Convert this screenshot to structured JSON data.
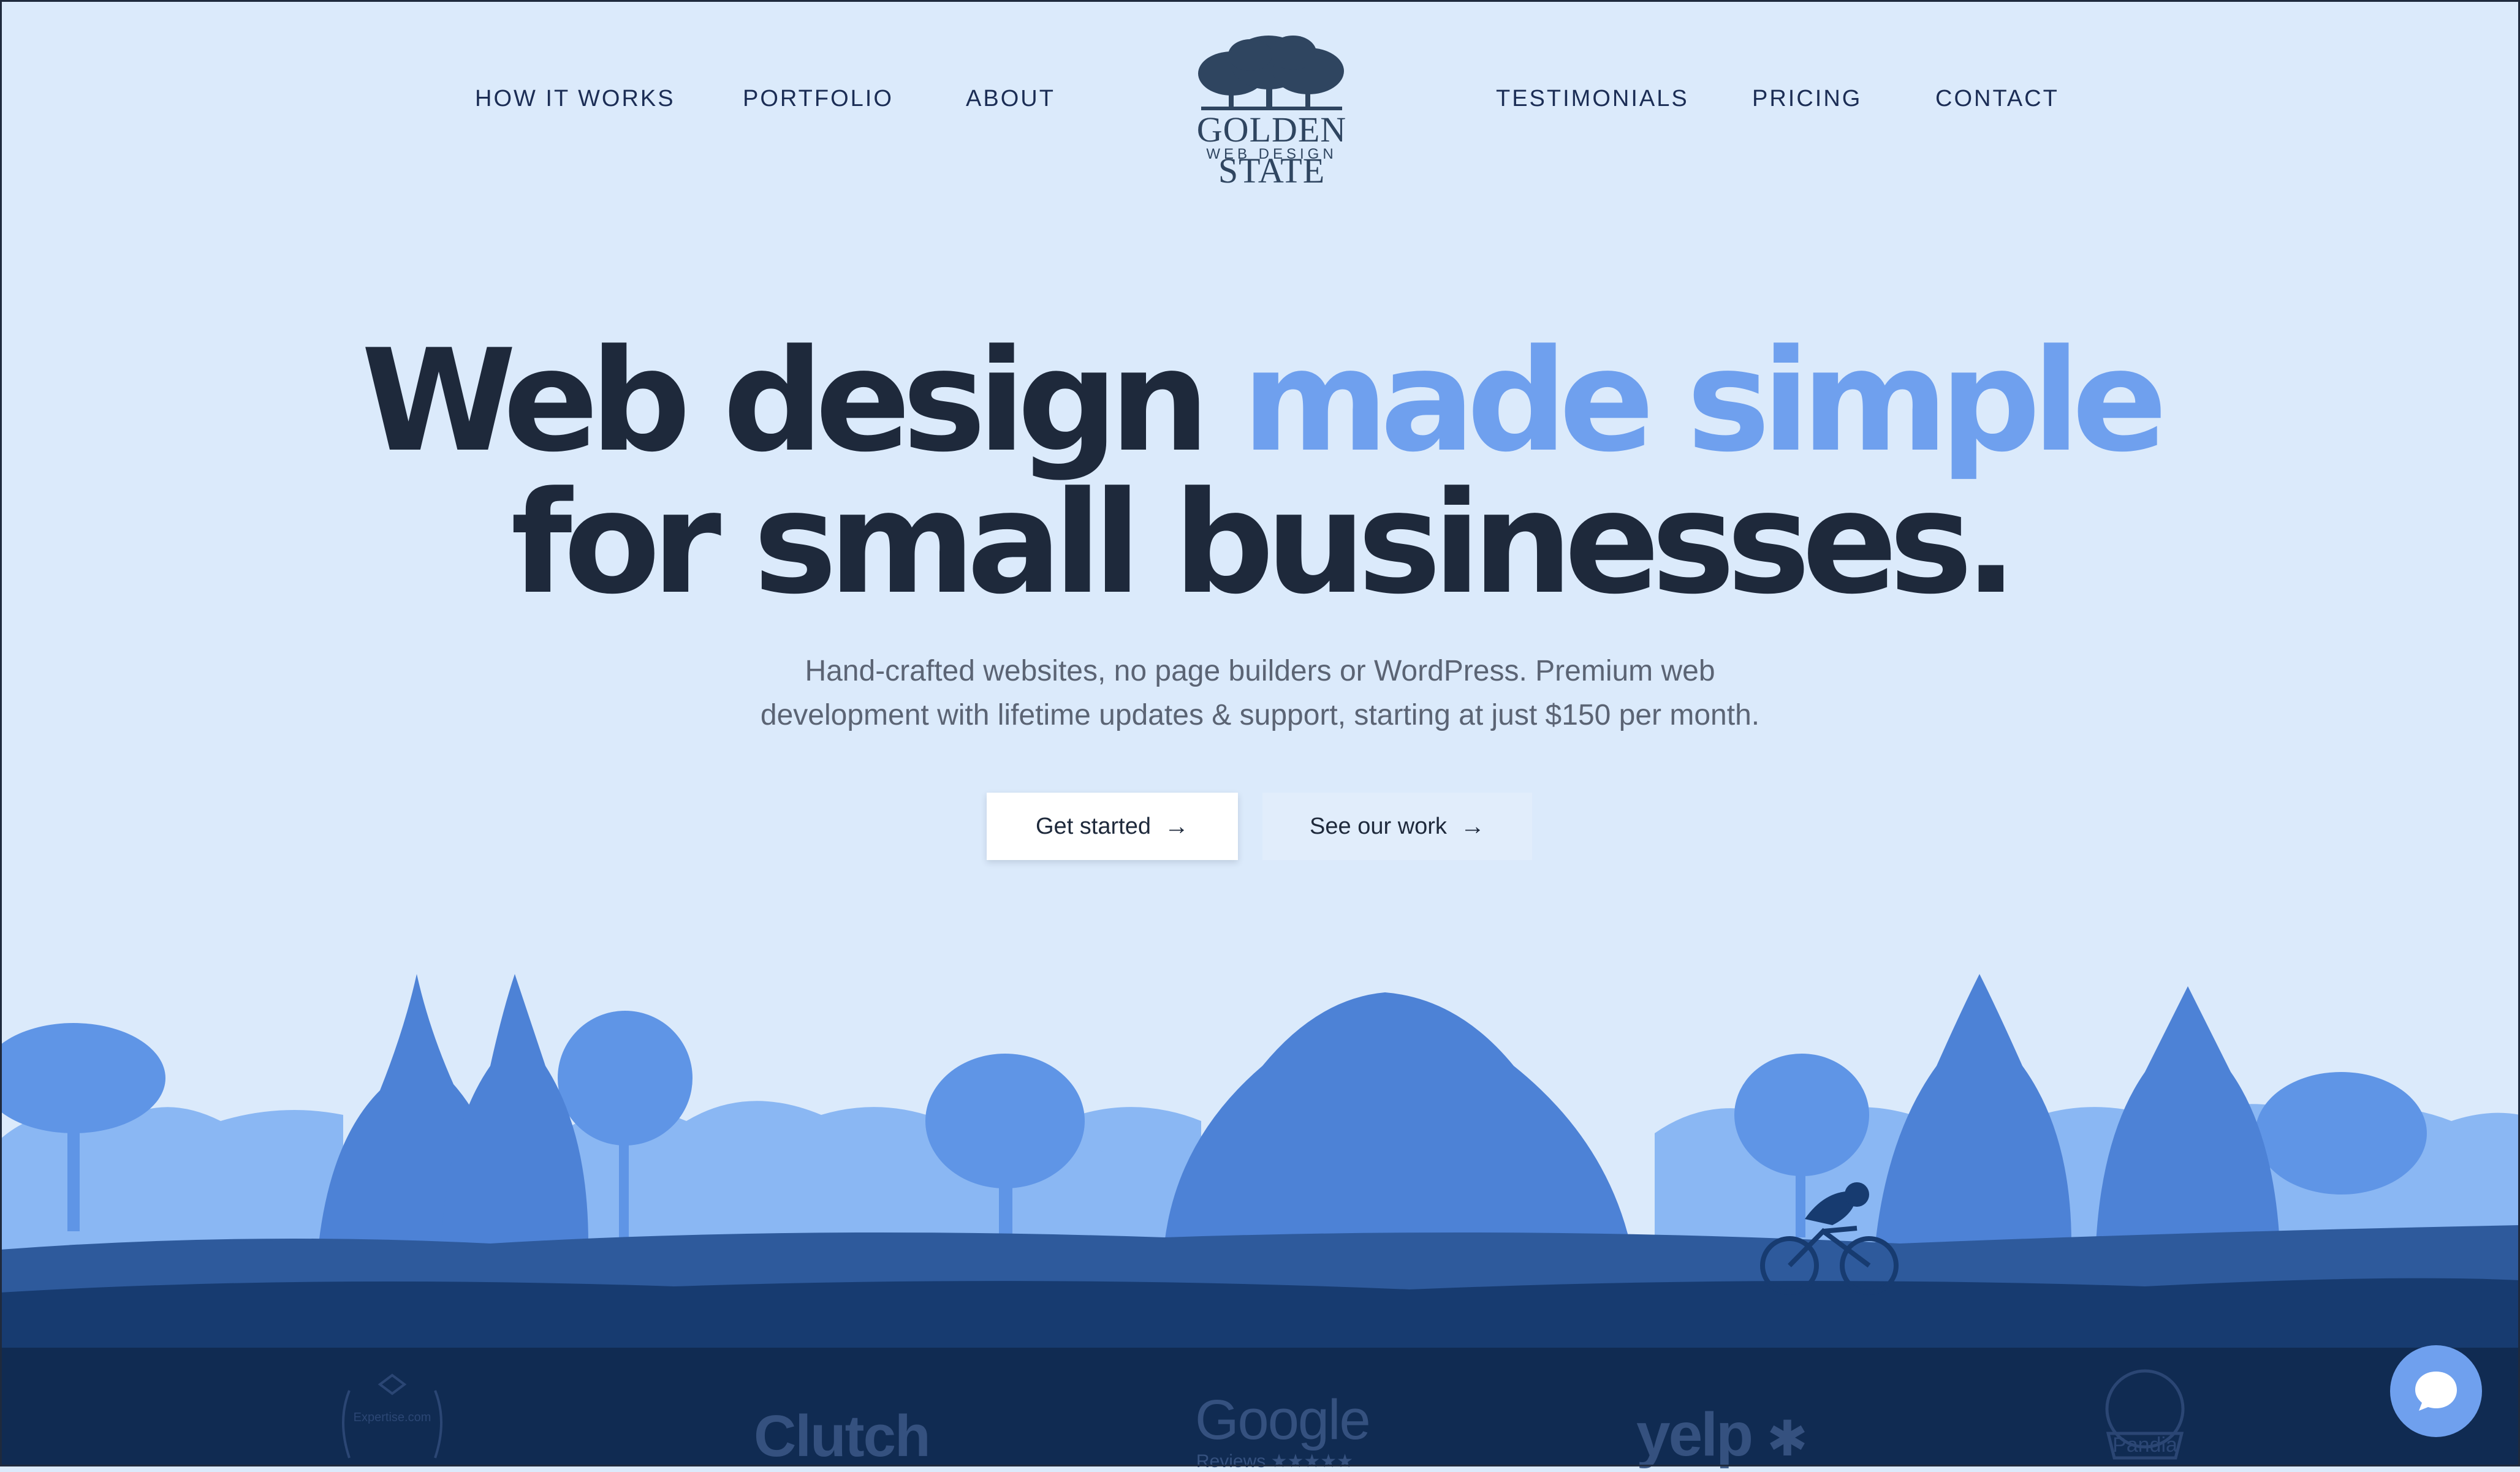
{
  "nav": {
    "left_links": [
      "HOW IT WORKS",
      "PORTFOLIO",
      "ABOUT"
    ],
    "right_links": [
      "TESTIMONIALS",
      "PRICING",
      "CONTACT"
    ],
    "logo_title": "GOLDEN STATE",
    "logo_subtitle": "WEB DESIGN"
  },
  "hero": {
    "title_part1": "Web design ",
    "title_accent": "made simple",
    "title_part2": "for small businesses.",
    "subtitle_line1": "Hand-crafted websites, no page builders or WordPress. Premium web",
    "subtitle_line2": "development with lifetime updates & support, starting at just $150 per month.",
    "primary_button": "Get started",
    "secondary_button": "See our work"
  },
  "badges": {
    "expertise": "Expertise.com",
    "clutch": "Clutch",
    "google": "Google",
    "google_sub": "Reviews ★★★★★",
    "yelp": "yelp",
    "pandia": "Pandia"
  },
  "colors": {
    "background": "#dbeafb",
    "heading": "#1e293b",
    "accent": "#6fa0ee",
    "ground": "#0f2a52"
  },
  "icons": [
    "arrow-right-icon",
    "chat-bubble-icon",
    "oak-tree-logo-icon",
    "yelp-burst-icon"
  ]
}
